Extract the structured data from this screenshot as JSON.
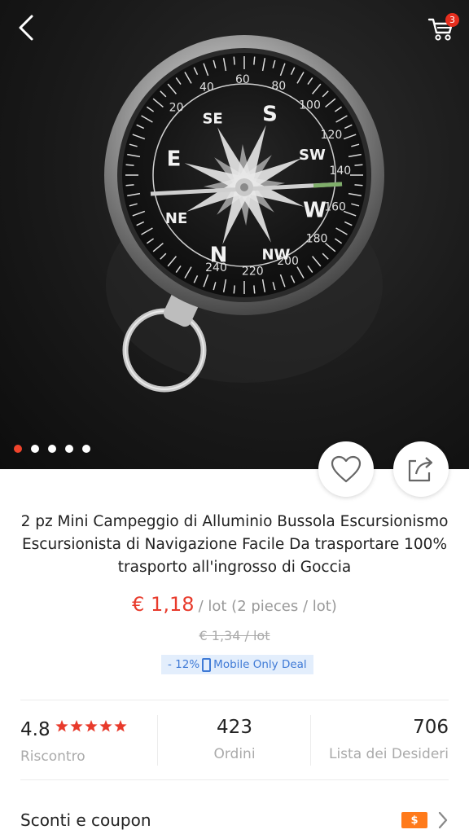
{
  "header": {
    "cart_count": "3"
  },
  "gallery": {
    "image_count": 5,
    "active_index": 0,
    "compass_degrees": [
      "20",
      "40",
      "60",
      "80",
      "100",
      "120",
      "140",
      "160",
      "180",
      "200",
      "220",
      "240"
    ],
    "compass_directions": [
      "S",
      "SW",
      "W",
      "NW",
      "N",
      "NE",
      "E",
      "SE"
    ]
  },
  "product": {
    "title": "2 pz Mini Campeggio di Alluminio Bussola Escursionismo Escursionista di Navigazione Facile Da trasportare 100% trasporto all'ingrosso di Goccia",
    "price": "€ 1,18",
    "unit": "/ lot (2 pieces / lot)",
    "original_price": "€ 1,34  / lot",
    "deal_discount": "- 12%",
    "deal_label": "Mobile Only Deal"
  },
  "stats": {
    "rating": "4.8",
    "rating_stars": 5,
    "rating_label": "Riscontro",
    "orders": "423",
    "orders_label": "Ordini",
    "wishlist": "706",
    "wishlist_label": "Lista dei Desideri"
  },
  "coupons": {
    "label": "Sconti e coupon",
    "tag": "$"
  },
  "colors": {
    "accent": "#e83a2b",
    "deal_text": "#3f7ad6",
    "deal_bg": "#e3eefc",
    "coupon_tag": "#ff7a1a"
  }
}
